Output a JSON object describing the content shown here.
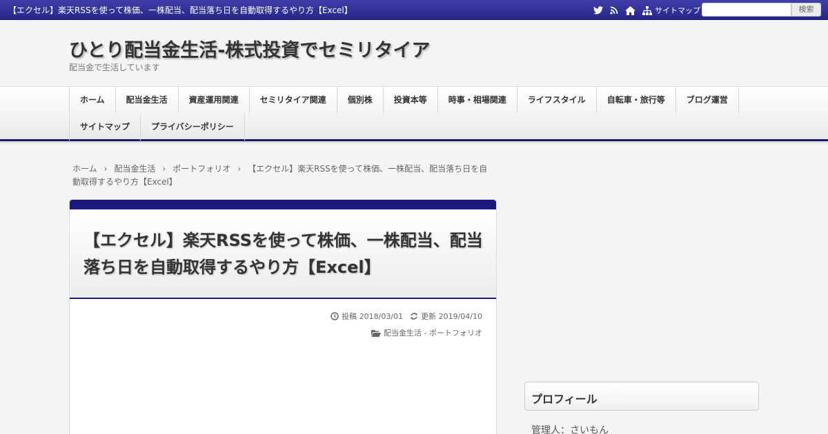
{
  "topbar": {
    "title": "【エクセル】楽天RSSを使って株価、一株配当、配当落ち日を自動取得するやり方【Excel】",
    "icons": [
      "twitter-icon",
      "rss-icon",
      "home-icon",
      "sitemap-icon"
    ],
    "sitemap_label": "サイトマップ",
    "search_button": "検索",
    "search_value": "",
    "color": "#2e2e96"
  },
  "header": {
    "site_title": "ひとり配当金生活-株式投資でセミリタイア",
    "site_description": "配当金で生活しています"
  },
  "nav": {
    "row1": [
      "ホーム",
      "配当金生活",
      "資産運用関連",
      "セミリタイア関連",
      "個別株",
      "投資本等",
      "時事・相場関連",
      "ライフスタイル",
      "自転車・旅行等",
      "ブログ運営"
    ],
    "row2": [
      "サイトマップ",
      "プライバシーポリシー"
    ],
    "accent": "#1a1a6e"
  },
  "breadcrumb": {
    "items": [
      "ホーム",
      "配当金生活",
      "ポートフォリオ"
    ],
    "separator": "›",
    "current": "【エクセル】楽天RSSを使って株価、一株配当、配当落ち日を自動取得するやり方【Excel】"
  },
  "article": {
    "title": "【エクセル】楽天RSSを使って株価、一株配当、配当落ち日を自動取得するやり方【Excel】",
    "posted_label": "投稿",
    "posted_date": "2018/03/01",
    "updated_label": "更新",
    "updated_date": "2019/04/10",
    "categories": "配当金生活 - ポートフォリオ"
  },
  "sidebar": {
    "profile_title": "プロフィール",
    "admin": "管理人：さいもん"
  }
}
